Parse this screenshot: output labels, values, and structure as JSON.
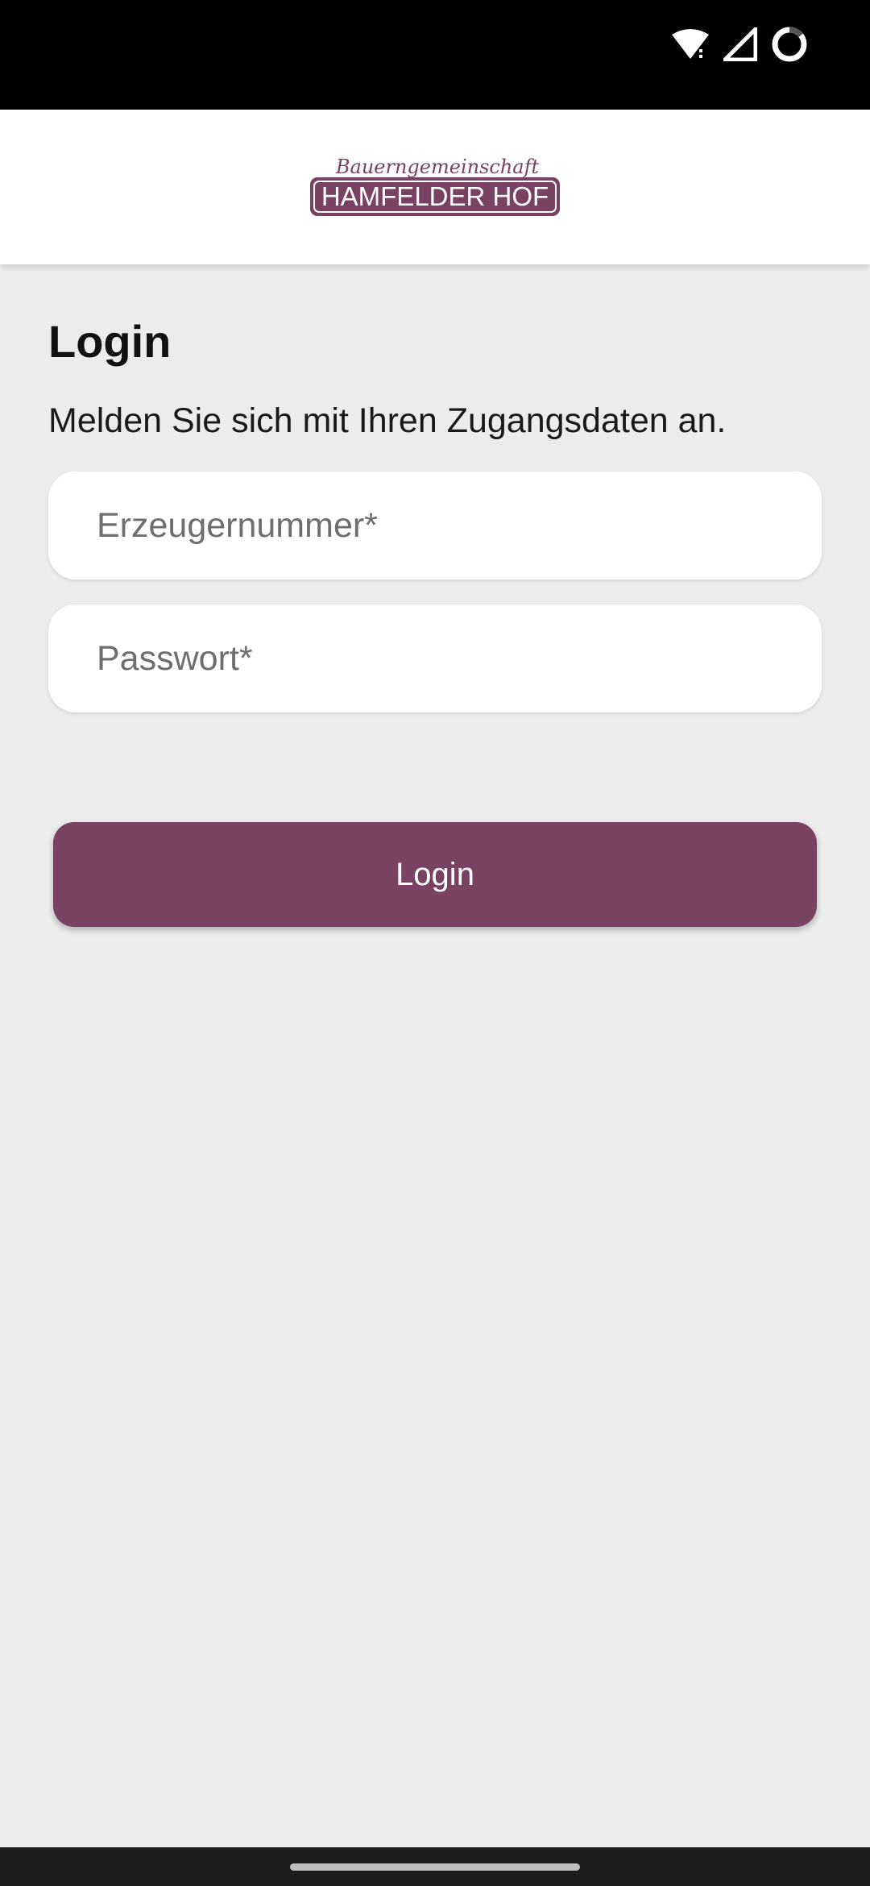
{
  "status_bar": {
    "icons": [
      "wifi-icon",
      "cellular-signal-icon",
      "battery-loading-icon"
    ]
  },
  "header": {
    "logo": {
      "script_text": "Bauerngemeinschaft",
      "brand_text": "HAMFELDER HOF",
      "color": "#7a4262"
    }
  },
  "login": {
    "title": "Login",
    "subtitle": "Melden Sie sich mit Ihren Zugangsdaten an.",
    "username_field": {
      "placeholder": "Erzeugernummer*",
      "value": ""
    },
    "password_field": {
      "placeholder": "Passwort*",
      "value": ""
    },
    "submit_label": "Login"
  },
  "colors": {
    "accent": "#7a4262",
    "background": "#ececec",
    "surface": "#ffffff"
  }
}
